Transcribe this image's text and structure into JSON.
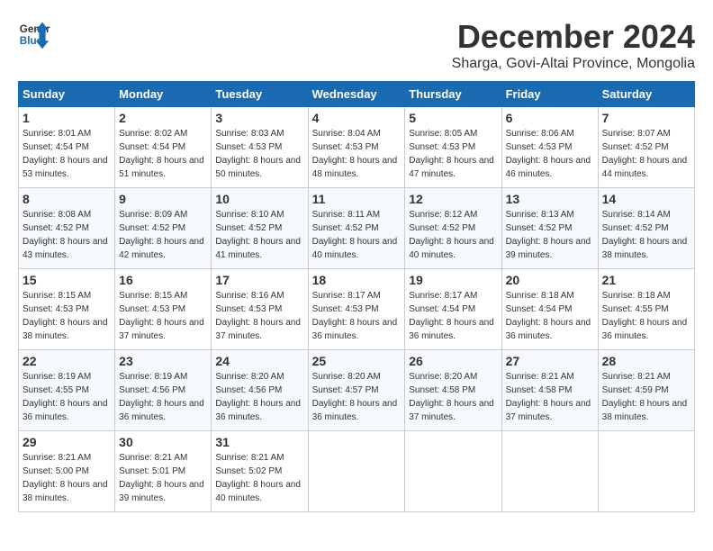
{
  "logo": {
    "line1": "General",
    "line2": "Blue"
  },
  "title": "December 2024",
  "location": "Sharga, Govi-Altai Province, Mongolia",
  "days_of_week": [
    "Sunday",
    "Monday",
    "Tuesday",
    "Wednesday",
    "Thursday",
    "Friday",
    "Saturday"
  ],
  "weeks": [
    [
      {
        "day": "1",
        "sunrise": "8:01 AM",
        "sunset": "4:54 PM",
        "daylight": "8 hours and 53 minutes."
      },
      {
        "day": "2",
        "sunrise": "8:02 AM",
        "sunset": "4:54 PM",
        "daylight": "8 hours and 51 minutes."
      },
      {
        "day": "3",
        "sunrise": "8:03 AM",
        "sunset": "4:53 PM",
        "daylight": "8 hours and 50 minutes."
      },
      {
        "day": "4",
        "sunrise": "8:04 AM",
        "sunset": "4:53 PM",
        "daylight": "8 hours and 48 minutes."
      },
      {
        "day": "5",
        "sunrise": "8:05 AM",
        "sunset": "4:53 PM",
        "daylight": "8 hours and 47 minutes."
      },
      {
        "day": "6",
        "sunrise": "8:06 AM",
        "sunset": "4:53 PM",
        "daylight": "8 hours and 46 minutes."
      },
      {
        "day": "7",
        "sunrise": "8:07 AM",
        "sunset": "4:52 PM",
        "daylight": "8 hours and 44 minutes."
      }
    ],
    [
      {
        "day": "8",
        "sunrise": "8:08 AM",
        "sunset": "4:52 PM",
        "daylight": "8 hours and 43 minutes."
      },
      {
        "day": "9",
        "sunrise": "8:09 AM",
        "sunset": "4:52 PM",
        "daylight": "8 hours and 42 minutes."
      },
      {
        "day": "10",
        "sunrise": "8:10 AM",
        "sunset": "4:52 PM",
        "daylight": "8 hours and 41 minutes."
      },
      {
        "day": "11",
        "sunrise": "8:11 AM",
        "sunset": "4:52 PM",
        "daylight": "8 hours and 40 minutes."
      },
      {
        "day": "12",
        "sunrise": "8:12 AM",
        "sunset": "4:52 PM",
        "daylight": "8 hours and 40 minutes."
      },
      {
        "day": "13",
        "sunrise": "8:13 AM",
        "sunset": "4:52 PM",
        "daylight": "8 hours and 39 minutes."
      },
      {
        "day": "14",
        "sunrise": "8:14 AM",
        "sunset": "4:52 PM",
        "daylight": "8 hours and 38 minutes."
      }
    ],
    [
      {
        "day": "15",
        "sunrise": "8:15 AM",
        "sunset": "4:53 PM",
        "daylight": "8 hours and 38 minutes."
      },
      {
        "day": "16",
        "sunrise": "8:15 AM",
        "sunset": "4:53 PM",
        "daylight": "8 hours and 37 minutes."
      },
      {
        "day": "17",
        "sunrise": "8:16 AM",
        "sunset": "4:53 PM",
        "daylight": "8 hours and 37 minutes."
      },
      {
        "day": "18",
        "sunrise": "8:17 AM",
        "sunset": "4:53 PM",
        "daylight": "8 hours and 36 minutes."
      },
      {
        "day": "19",
        "sunrise": "8:17 AM",
        "sunset": "4:54 PM",
        "daylight": "8 hours and 36 minutes."
      },
      {
        "day": "20",
        "sunrise": "8:18 AM",
        "sunset": "4:54 PM",
        "daylight": "8 hours and 36 minutes."
      },
      {
        "day": "21",
        "sunrise": "8:18 AM",
        "sunset": "4:55 PM",
        "daylight": "8 hours and 36 minutes."
      }
    ],
    [
      {
        "day": "22",
        "sunrise": "8:19 AM",
        "sunset": "4:55 PM",
        "daylight": "8 hours and 36 minutes."
      },
      {
        "day": "23",
        "sunrise": "8:19 AM",
        "sunset": "4:56 PM",
        "daylight": "8 hours and 36 minutes."
      },
      {
        "day": "24",
        "sunrise": "8:20 AM",
        "sunset": "4:56 PM",
        "daylight": "8 hours and 36 minutes."
      },
      {
        "day": "25",
        "sunrise": "8:20 AM",
        "sunset": "4:57 PM",
        "daylight": "8 hours and 36 minutes."
      },
      {
        "day": "26",
        "sunrise": "8:20 AM",
        "sunset": "4:58 PM",
        "daylight": "8 hours and 37 minutes."
      },
      {
        "day": "27",
        "sunrise": "8:21 AM",
        "sunset": "4:58 PM",
        "daylight": "8 hours and 37 minutes."
      },
      {
        "day": "28",
        "sunrise": "8:21 AM",
        "sunset": "4:59 PM",
        "daylight": "8 hours and 38 minutes."
      }
    ],
    [
      {
        "day": "29",
        "sunrise": "8:21 AM",
        "sunset": "5:00 PM",
        "daylight": "8 hours and 38 minutes."
      },
      {
        "day": "30",
        "sunrise": "8:21 AM",
        "sunset": "5:01 PM",
        "daylight": "8 hours and 39 minutes."
      },
      {
        "day": "31",
        "sunrise": "8:21 AM",
        "sunset": "5:02 PM",
        "daylight": "8 hours and 40 minutes."
      },
      null,
      null,
      null,
      null
    ]
  ],
  "labels": {
    "sunrise": "Sunrise:",
    "sunset": "Sunset:",
    "daylight": "Daylight:"
  }
}
